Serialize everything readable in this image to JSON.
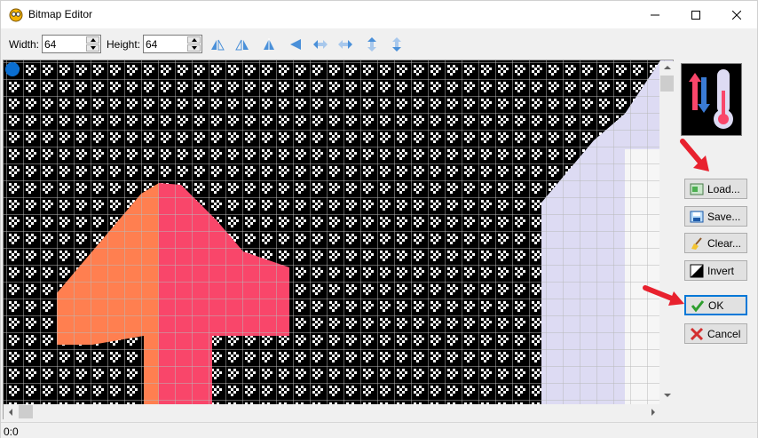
{
  "window": {
    "title": "Bitmap Editor"
  },
  "toolbar": {
    "width_label": "Width:",
    "width_value": "64",
    "height_label": "Height:",
    "height_value": "64",
    "tools": [
      "flip-horizontal-icon",
      "flip-vertical-icon",
      "mirror-icon",
      "rotate-icon",
      "shift-left-icon",
      "shift-right-icon",
      "shift-up-icon",
      "shift-down-icon"
    ]
  },
  "buttons": {
    "load": "Load...",
    "save": "Save...",
    "clear": "Clear...",
    "invert": "Invert",
    "ok": "OK",
    "cancel": "Cancel"
  },
  "status": {
    "coords": "0:0"
  },
  "colors": {
    "accent": "#0078d7",
    "arrow_orange": "#ff7f50",
    "arrow_pink": "#f9466a",
    "thermo_lavender": "#dddbf3",
    "annotation_red": "#e8212e"
  }
}
